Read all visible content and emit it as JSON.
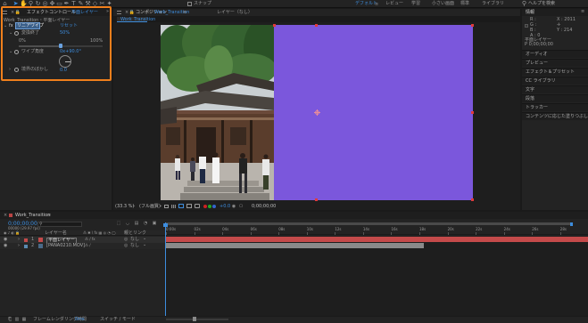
{
  "toolbar": {
    "snap": "スナップ",
    "workspaces": [
      "デフォルト",
      "レビュー",
      "学習",
      "小さい画面",
      "標準",
      "ライブラリ"
    ],
    "search_placeholder": "ヘルプを検索"
  },
  "effect_controls": {
    "tab_label": "エフェクトコントロール",
    "tab_layer": "平面レイヤー",
    "breadcrumb": "Work_Transition・平面レイヤー",
    "fx_label": "リニアワイプ",
    "reset": "リセット",
    "completion_label": "変換終了",
    "completion_value": "50%",
    "slider_min": "0%",
    "slider_max": "100%",
    "slider_position": 0.5,
    "angle_label": "ワイプ角度",
    "angle_value": "0x+90.0°",
    "feather_label": "境界のぼかし",
    "feather_value": "0.0"
  },
  "composition": {
    "tab_label": "コンポジション",
    "tab_name": "Work_Transition",
    "layer_tab": "レイヤー（なし）",
    "crumb": "Work_Transition",
    "solid_color": "#7b57dc",
    "zoom": "(33.3 %)",
    "quality": "(フル画質)",
    "timecode": "0;00;00;00"
  },
  "info_panel": {
    "title": "情報",
    "r": "R :",
    "g": "G :",
    "b": "B :",
    "a": "A : 0",
    "x": "X : 2011",
    "y": "Y : 214",
    "layer_name": "平面レイヤー",
    "time_line": "P 0;00;00;00",
    "sub_line": "E 0;00;…  0;00;00;00"
  },
  "right_panels": [
    "オーディオ",
    "プレビュー",
    "エフェクト＆プリセット",
    "CC ライブラリ",
    "文字",
    "段落",
    "トラッカー",
    "コンテンツに応じた塗りつぶし"
  ],
  "timeline": {
    "tab_name": "Work_Transition",
    "timecode": "0;00;00;00",
    "fps": "00000 (29.97 fps)",
    "columns": {
      "layer_name": "レイヤー名",
      "parent": "親とリンク"
    },
    "layers": [
      {
        "num": "1",
        "name": "平面レイヤー",
        "parent": "なし",
        "color": "#c44a4a"
      },
      {
        "num": "2",
        "name": "[PANA0210.MOV]",
        "parent": "なし",
        "color": "#5a8ab0"
      }
    ],
    "ruler_labels": [
      "0:00s",
      "02s",
      "04s",
      "06s",
      "08s",
      "10s",
      "12s",
      "14s",
      "16s",
      "18s",
      "20s",
      "22s",
      "24s",
      "26s",
      "28s"
    ],
    "bar_colors": {
      "layer1": "#c44a4a",
      "layer2": "#8a8a8a"
    },
    "layer2_fraction": 0.61,
    "footer_left": "フレームレンダリング時間",
    "footer_ms": "0ms",
    "footer_mode": "スイッチ / モード"
  }
}
